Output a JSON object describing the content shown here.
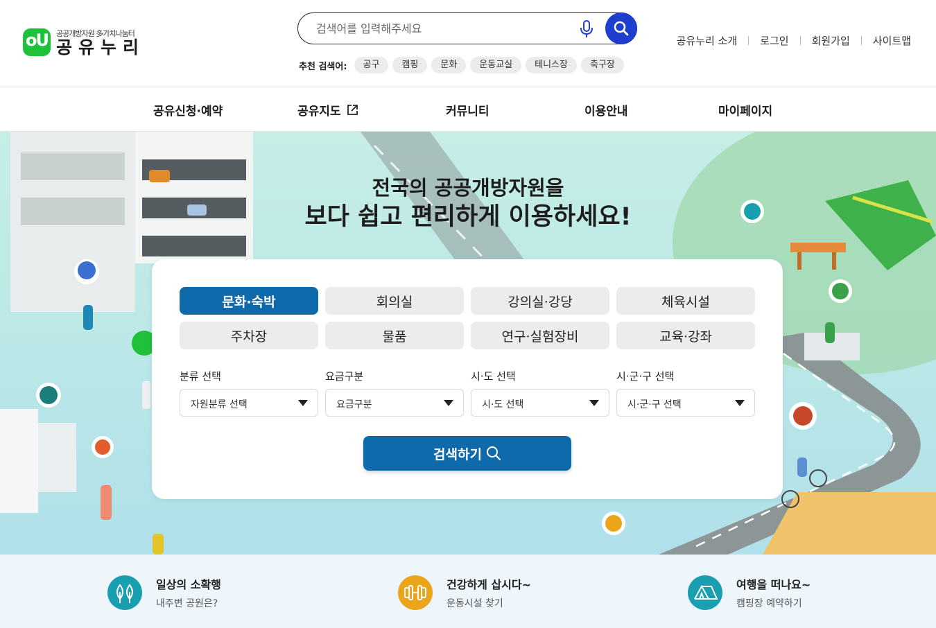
{
  "header": {
    "logo": {
      "sub": "공공개방자원 多가치나눔터",
      "main": "공유누리",
      "mark": "oU"
    },
    "search": {
      "placeholder": "검색어를 입력해주세요"
    },
    "recommend": {
      "label": "추천 검색어:",
      "chips": [
        "공구",
        "캠핑",
        "문화",
        "운동교실",
        "테니스장",
        "축구장"
      ]
    },
    "util_links": [
      "공유누리 소개",
      "로그인",
      "회원가입",
      "사이트맵"
    ]
  },
  "gnb": {
    "items": [
      "공유신청·예약",
      "공유지도",
      "커뮤니티",
      "이용안내",
      "마이페이지"
    ]
  },
  "hero": {
    "title_line1": "전국의 공공개방자원을",
    "title_line2": "보다 쉽고 편리하게 이용하세요!",
    "categories": [
      "문화·숙박",
      "회의실",
      "강의실·강당",
      "체육시설",
      "주차장",
      "물품",
      "연구·실험장비",
      "교육·강좌"
    ],
    "active_category": "문화·숙박",
    "filters": [
      {
        "label": "분류 선택",
        "value": "자원분류 선택"
      },
      {
        "label": "요금구분",
        "value": "요금구분"
      },
      {
        "label": "시·도 선택",
        "value": "시·도 선택"
      },
      {
        "label": "시·군·구 선택",
        "value": "시·군·구 선택"
      }
    ],
    "search_button": "검색하기"
  },
  "quick_links": [
    {
      "title": "일상의 소확행",
      "sub": "내주변 공원은?",
      "icon": "tree-icon",
      "color": "#1a9fb0"
    },
    {
      "title": "건강하게 삽시다~",
      "sub": "운동시설 찾기",
      "icon": "dumbbell-icon",
      "color": "#eaa51a"
    },
    {
      "title": "여행을 떠나요~",
      "sub": "캠핑장 예약하기",
      "icon": "tent-icon",
      "color": "#1a9fb0"
    }
  ],
  "colors": {
    "primary": "#0f6aab",
    "search_button": "#1f3ed0",
    "logo_green": "#1ec13a"
  }
}
